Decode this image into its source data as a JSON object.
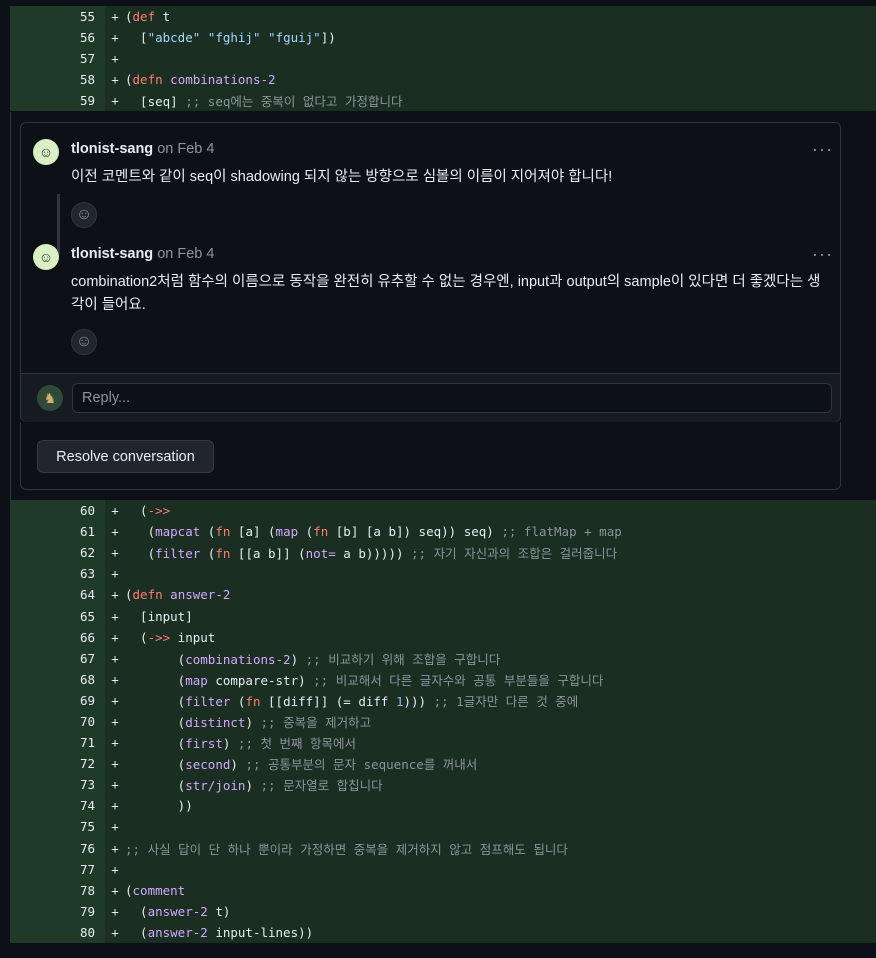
{
  "top_lines": [
    {
      "num": "55",
      "marker": "+",
      "tokens": [
        [
          "",
          "("
        ],
        [
          "kw",
          "def"
        ],
        [
          "",
          " t"
        ]
      ]
    },
    {
      "num": "56",
      "marker": "+",
      "tokens": [
        [
          "",
          "  ["
        ],
        [
          "str",
          "\"abcde\""
        ],
        [
          "",
          " "
        ],
        [
          "str",
          "\"fghij\""
        ],
        [
          "",
          " "
        ],
        [
          "str",
          "\"fguij\""
        ],
        [
          "",
          "])"
        ]
      ]
    },
    {
      "num": "57",
      "marker": "+",
      "tokens": []
    },
    {
      "num": "58",
      "marker": "+",
      "tokens": [
        [
          "",
          "("
        ],
        [
          "kw",
          "defn"
        ],
        [
          "",
          " "
        ],
        [
          "fn",
          "combinations-2"
        ]
      ]
    },
    {
      "num": "59",
      "marker": "+",
      "tokens": [
        [
          "",
          "  [seq] "
        ],
        [
          "cm",
          ";; seq에는 중복이 없다고 가정합니다"
        ]
      ]
    }
  ],
  "comments": [
    {
      "author": "tlonist-sang",
      "date": "on Feb 4",
      "body": "이전 코멘트와 같이 seq이 shadowing 되지 않는 방향으로 심볼의 이름이 지어져야 합니다!"
    },
    {
      "author": "tlonist-sang",
      "date": "on Feb 4",
      "body": "combination2처럼 함수의 이름으로 동작을 완전히 유추할 수 없는 경우엔, input과 output의 sample이 있다면 더 좋겠다는 생각이 들어요."
    }
  ],
  "more_label": "···",
  "reply_placeholder": "Reply...",
  "resolve_label": "Resolve conversation",
  "icons": {
    "avatar": "avatar-icon",
    "smiley": "smiley-icon",
    "kebab": "kebab-icon"
  },
  "bottom_lines": [
    {
      "num": "60",
      "marker": "+",
      "tokens": [
        [
          "",
          "  ("
        ],
        [
          "kw",
          "->>"
        ]
      ]
    },
    {
      "num": "61",
      "marker": "+",
      "tokens": [
        [
          "",
          "   ("
        ],
        [
          "fn",
          "mapcat"
        ],
        [
          "",
          " ("
        ],
        [
          "kw",
          "fn"
        ],
        [
          "",
          " [a] ("
        ],
        [
          "fn",
          "map"
        ],
        [
          "",
          " ("
        ],
        [
          "kw",
          "fn"
        ],
        [
          "",
          " [b] [a b]) seq)) seq) "
        ],
        [
          "cm",
          ";; flatMap + map"
        ]
      ]
    },
    {
      "num": "62",
      "marker": "+",
      "tokens": [
        [
          "",
          "   ("
        ],
        [
          "fn",
          "filter"
        ],
        [
          "",
          " ("
        ],
        [
          "kw",
          "fn"
        ],
        [
          "",
          " [[a b]] ("
        ],
        [
          "fn",
          "not="
        ],
        [
          "",
          " a b))))) "
        ],
        [
          "cm",
          ";; 자기 자신과의 조합은 걸러줍니다"
        ]
      ]
    },
    {
      "num": "63",
      "marker": "+",
      "tokens": []
    },
    {
      "num": "64",
      "marker": "+",
      "tokens": [
        [
          "",
          "("
        ],
        [
          "kw",
          "defn"
        ],
        [
          "",
          " "
        ],
        [
          "fn",
          "answer-2"
        ]
      ]
    },
    {
      "num": "65",
      "marker": "+",
      "tokens": [
        [
          "",
          "  [input]"
        ]
      ]
    },
    {
      "num": "66",
      "marker": "+",
      "tokens": [
        [
          "",
          "  ("
        ],
        [
          "kw",
          "->>"
        ],
        [
          "",
          " input"
        ]
      ]
    },
    {
      "num": "67",
      "marker": "+",
      "tokens": [
        [
          "",
          "       ("
        ],
        [
          "fn",
          "combinations-2"
        ],
        [
          "",
          ") "
        ],
        [
          "cm",
          ";; 비교하기 위해 조합을 구합니다"
        ]
      ]
    },
    {
      "num": "68",
      "marker": "+",
      "tokens": [
        [
          "",
          "       ("
        ],
        [
          "fn",
          "map"
        ],
        [
          "",
          " compare-str) "
        ],
        [
          "cm",
          ";; 비교해서 다른 글자수와 공통 부분들을 구합니다"
        ]
      ]
    },
    {
      "num": "69",
      "marker": "+",
      "tokens": [
        [
          "",
          "       ("
        ],
        [
          "fn",
          "filter"
        ],
        [
          "",
          " ("
        ],
        [
          "kw",
          "fn"
        ],
        [
          "",
          " [[diff]] (= diff "
        ],
        [
          "num",
          "1"
        ],
        [
          "",
          "))) "
        ],
        [
          "cm",
          ";; 1글자만 다른 것 중에"
        ]
      ]
    },
    {
      "num": "70",
      "marker": "+",
      "tokens": [
        [
          "",
          "       ("
        ],
        [
          "fn",
          "distinct"
        ],
        [
          "",
          ") "
        ],
        [
          "cm",
          ";; 중복을 제거하고"
        ]
      ]
    },
    {
      "num": "71",
      "marker": "+",
      "tokens": [
        [
          "",
          "       ("
        ],
        [
          "fn",
          "first"
        ],
        [
          "",
          ") "
        ],
        [
          "cm",
          ";; 첫 번째 항목에서"
        ]
      ]
    },
    {
      "num": "72",
      "marker": "+",
      "tokens": [
        [
          "",
          "       ("
        ],
        [
          "fn",
          "second"
        ],
        [
          "",
          ") "
        ],
        [
          "cm",
          ";; 공통부분의 문자 sequence를 꺼내서"
        ]
      ]
    },
    {
      "num": "73",
      "marker": "+",
      "tokens": [
        [
          "",
          "       ("
        ],
        [
          "fn",
          "str/join"
        ],
        [
          "",
          ") "
        ],
        [
          "cm",
          ";; 문자열로 합칩니다"
        ]
      ]
    },
    {
      "num": "74",
      "marker": "+",
      "tokens": [
        [
          "",
          "       ))"
        ]
      ]
    },
    {
      "num": "75",
      "marker": "+",
      "tokens": []
    },
    {
      "num": "76",
      "marker": "+",
      "tokens": [
        [
          "cm",
          ";; 사실 답이 단 하나 뿐이라 가정하면 중복을 제거하지 않고 점프해도 됩니다"
        ]
      ]
    },
    {
      "num": "77",
      "marker": "+",
      "tokens": []
    },
    {
      "num": "78",
      "marker": "+",
      "tokens": [
        [
          "",
          "("
        ],
        [
          "fn",
          "comment"
        ]
      ]
    },
    {
      "num": "79",
      "marker": "+",
      "tokens": [
        [
          "",
          "  ("
        ],
        [
          "fn",
          "answer-2"
        ],
        [
          "",
          " t)"
        ]
      ]
    },
    {
      "num": "80",
      "marker": "+",
      "tokens": [
        [
          "",
          "  ("
        ],
        [
          "fn",
          "answer-2"
        ],
        [
          "",
          " input-lines))"
        ]
      ]
    }
  ]
}
